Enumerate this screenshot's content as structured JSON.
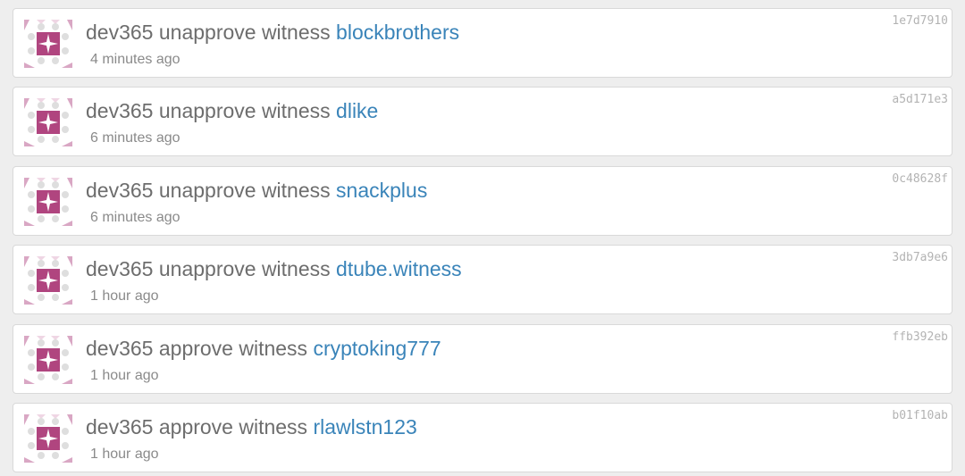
{
  "accent": {
    "link": "#3a84b9",
    "avatar": "#b0457f",
    "text": "#6d6d6d"
  },
  "feed": {
    "items": [
      {
        "user": "dev365",
        "action": "unapprove witness",
        "witness": "blockbrothers",
        "time": "4 minutes ago",
        "tx": "1e7d7910"
      },
      {
        "user": "dev365",
        "action": "unapprove witness",
        "witness": "dlike",
        "time": "6 minutes ago",
        "tx": "a5d171e3"
      },
      {
        "user": "dev365",
        "action": "unapprove witness",
        "witness": "snackplus",
        "time": "6 minutes ago",
        "tx": "0c48628f"
      },
      {
        "user": "dev365",
        "action": "unapprove witness",
        "witness": "dtube.witness",
        "time": "1 hour ago",
        "tx": "3db7a9e6"
      },
      {
        "user": "dev365",
        "action": "approve witness",
        "witness": "cryptoking777",
        "time": "1 hour ago",
        "tx": "ffb392eb"
      },
      {
        "user": "dev365",
        "action": "approve witness",
        "witness": "rlawlstn123",
        "time": "1 hour ago",
        "tx": "b01f10ab"
      }
    ]
  }
}
